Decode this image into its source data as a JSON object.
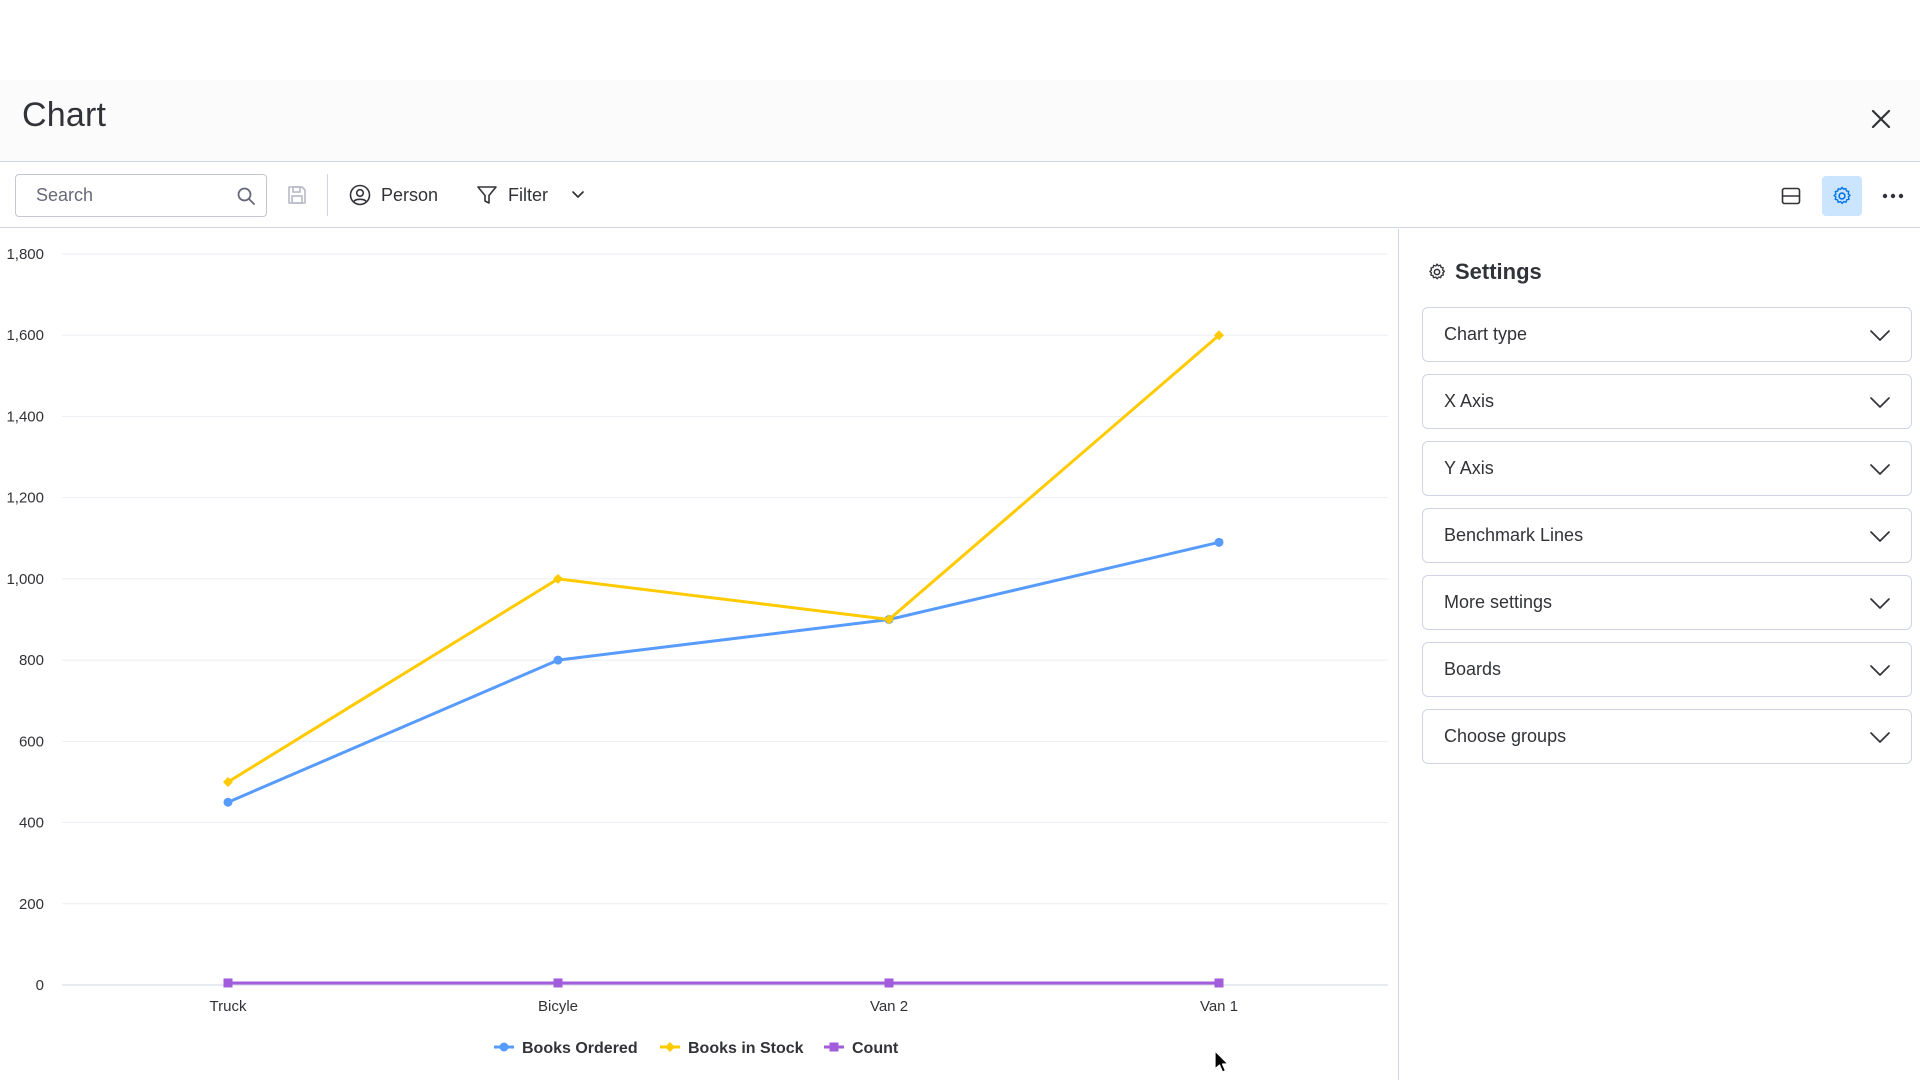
{
  "header": {
    "title": "Chart"
  },
  "toolbar": {
    "search_placeholder": "Search",
    "person_label": "Person",
    "filter_label": "Filter"
  },
  "settings_panel": {
    "title": "Settings",
    "items": [
      {
        "label": "Chart type"
      },
      {
        "label": "X Axis"
      },
      {
        "label": "Y Axis"
      },
      {
        "label": "Benchmark Lines"
      },
      {
        "label": "More settings"
      },
      {
        "label": "Boards"
      },
      {
        "label": "Choose groups"
      }
    ]
  },
  "colors": {
    "accent": "#0073ea",
    "settings_active_bg": "#cce5ff",
    "books_ordered": "#579bfc",
    "books_in_stock": "#ffcb00",
    "count": "#a25ddc"
  },
  "chart_data": {
    "type": "line",
    "categories": [
      "Truck",
      "Bicyle",
      "Van 2",
      "Van 1"
    ],
    "series": [
      {
        "name": "Books Ordered",
        "values": [
          450,
          800,
          900,
          1090
        ]
      },
      {
        "name": "Books in Stock",
        "values": [
          500,
          1000,
          900,
          1600
        ]
      },
      {
        "name": "Count",
        "values": [
          5,
          5,
          5,
          5
        ]
      }
    ],
    "ylim": [
      0,
      1800
    ],
    "yticks": [
      "0",
      "200",
      "400",
      "600",
      "800",
      "1,000",
      "1,200",
      "1,400",
      "1,600",
      "1,800"
    ],
    "grid": true,
    "legend": "bottom-center"
  }
}
